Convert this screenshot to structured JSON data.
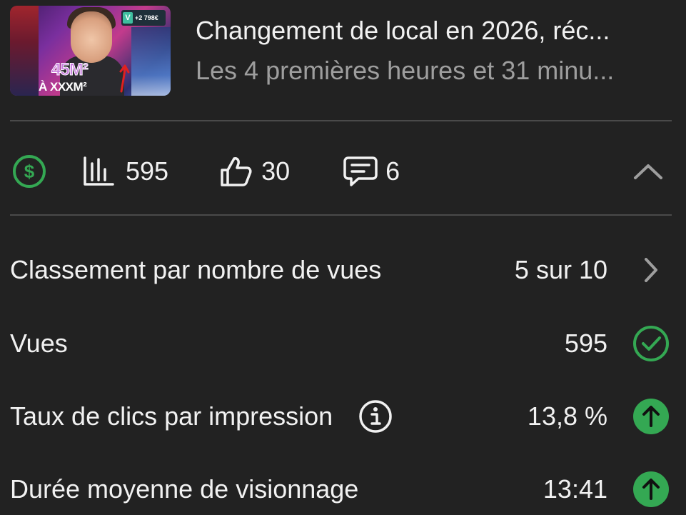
{
  "video": {
    "title": "Changement de local en 2026, réc...",
    "subtitle": "Les 4 premières heures et 31 minu...",
    "thumbnail": {
      "badge_letter": "V",
      "badge_amount": "+2 798€",
      "text_area_big": "45M²",
      "text_area_small": "À XXXM²"
    }
  },
  "stats": {
    "views": "595",
    "likes": "30",
    "comments": "6",
    "icons": [
      "dollar-icon",
      "bar-chart-icon",
      "thumbs-up-icon",
      "comment-icon",
      "chevron-up-icon"
    ]
  },
  "metrics": [
    {
      "label": "Classement par nombre de vues",
      "value": "5 sur 10",
      "trail": "chevron-right-icon"
    },
    {
      "label": "Vues",
      "value": "595",
      "trail": "check-circle-icon"
    },
    {
      "label": "Taux de clics par impression",
      "value": "13,8 %",
      "trail": "arrow-up-icon",
      "info": true
    },
    {
      "label": "Durée moyenne de visionnage",
      "value": "13:41",
      "trail": "arrow-up-icon"
    }
  ],
  "colors": {
    "background": "#222222",
    "accent_green": "#34a853",
    "text_primary": "#f1f1f1",
    "text_secondary": "#9e9e9e",
    "divider": "#4a4a4a"
  }
}
